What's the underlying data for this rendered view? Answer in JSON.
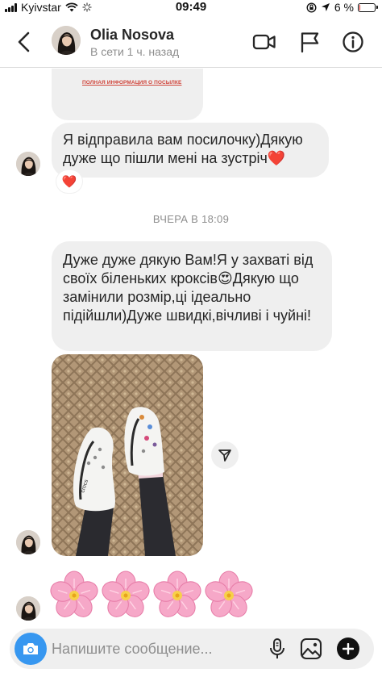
{
  "status_bar": {
    "carrier": "Kyivstar",
    "time": "09:49",
    "battery": "6 %",
    "battery_level": 0.06,
    "icons": [
      "signal-icon",
      "wifi-icon",
      "activity-icon",
      "screen-lock-icon",
      "location-icon",
      "battery-icon"
    ]
  },
  "header": {
    "name": "Olia Nosova",
    "status": "В сети 1 ч. назад",
    "icons": [
      "back-icon",
      "video-call-icon",
      "flag-icon",
      "info-icon"
    ]
  },
  "messages": {
    "card_link": "ПОЛНАЯ ИНФОРМАЦИЯ О ПОСЫЛКЕ",
    "msg1_text": "Я відправила вам посилочку)Дякую дуже що пішли мені на зустріч",
    "msg1_emoji": "❤️",
    "msg1_reaction": "❤️",
    "timestamp": "ВЧЕРА В 18:09",
    "msg2_text": "Дуже дуже дякую Вам!Я у захваті від своїх біленьких кроксів",
    "msg2_emoji": "😍",
    "msg2_text_end": "Дякую що замінили розмір,ці ідеально підійшли)Дуже швидкі,вічливі і чуйні!",
    "photo_shoe_text": "crocs",
    "flowers_count": 4
  },
  "composer": {
    "placeholder": "Напишите сообщение...",
    "icons": [
      "camera-icon",
      "microphone-icon",
      "gallery-icon",
      "plus-icon"
    ]
  },
  "colors": {
    "accent_blue": "#3797f0",
    "bubble_gray": "#efefef",
    "meta_gray": "#8e8e8e",
    "heart_red": "#e3263d"
  }
}
